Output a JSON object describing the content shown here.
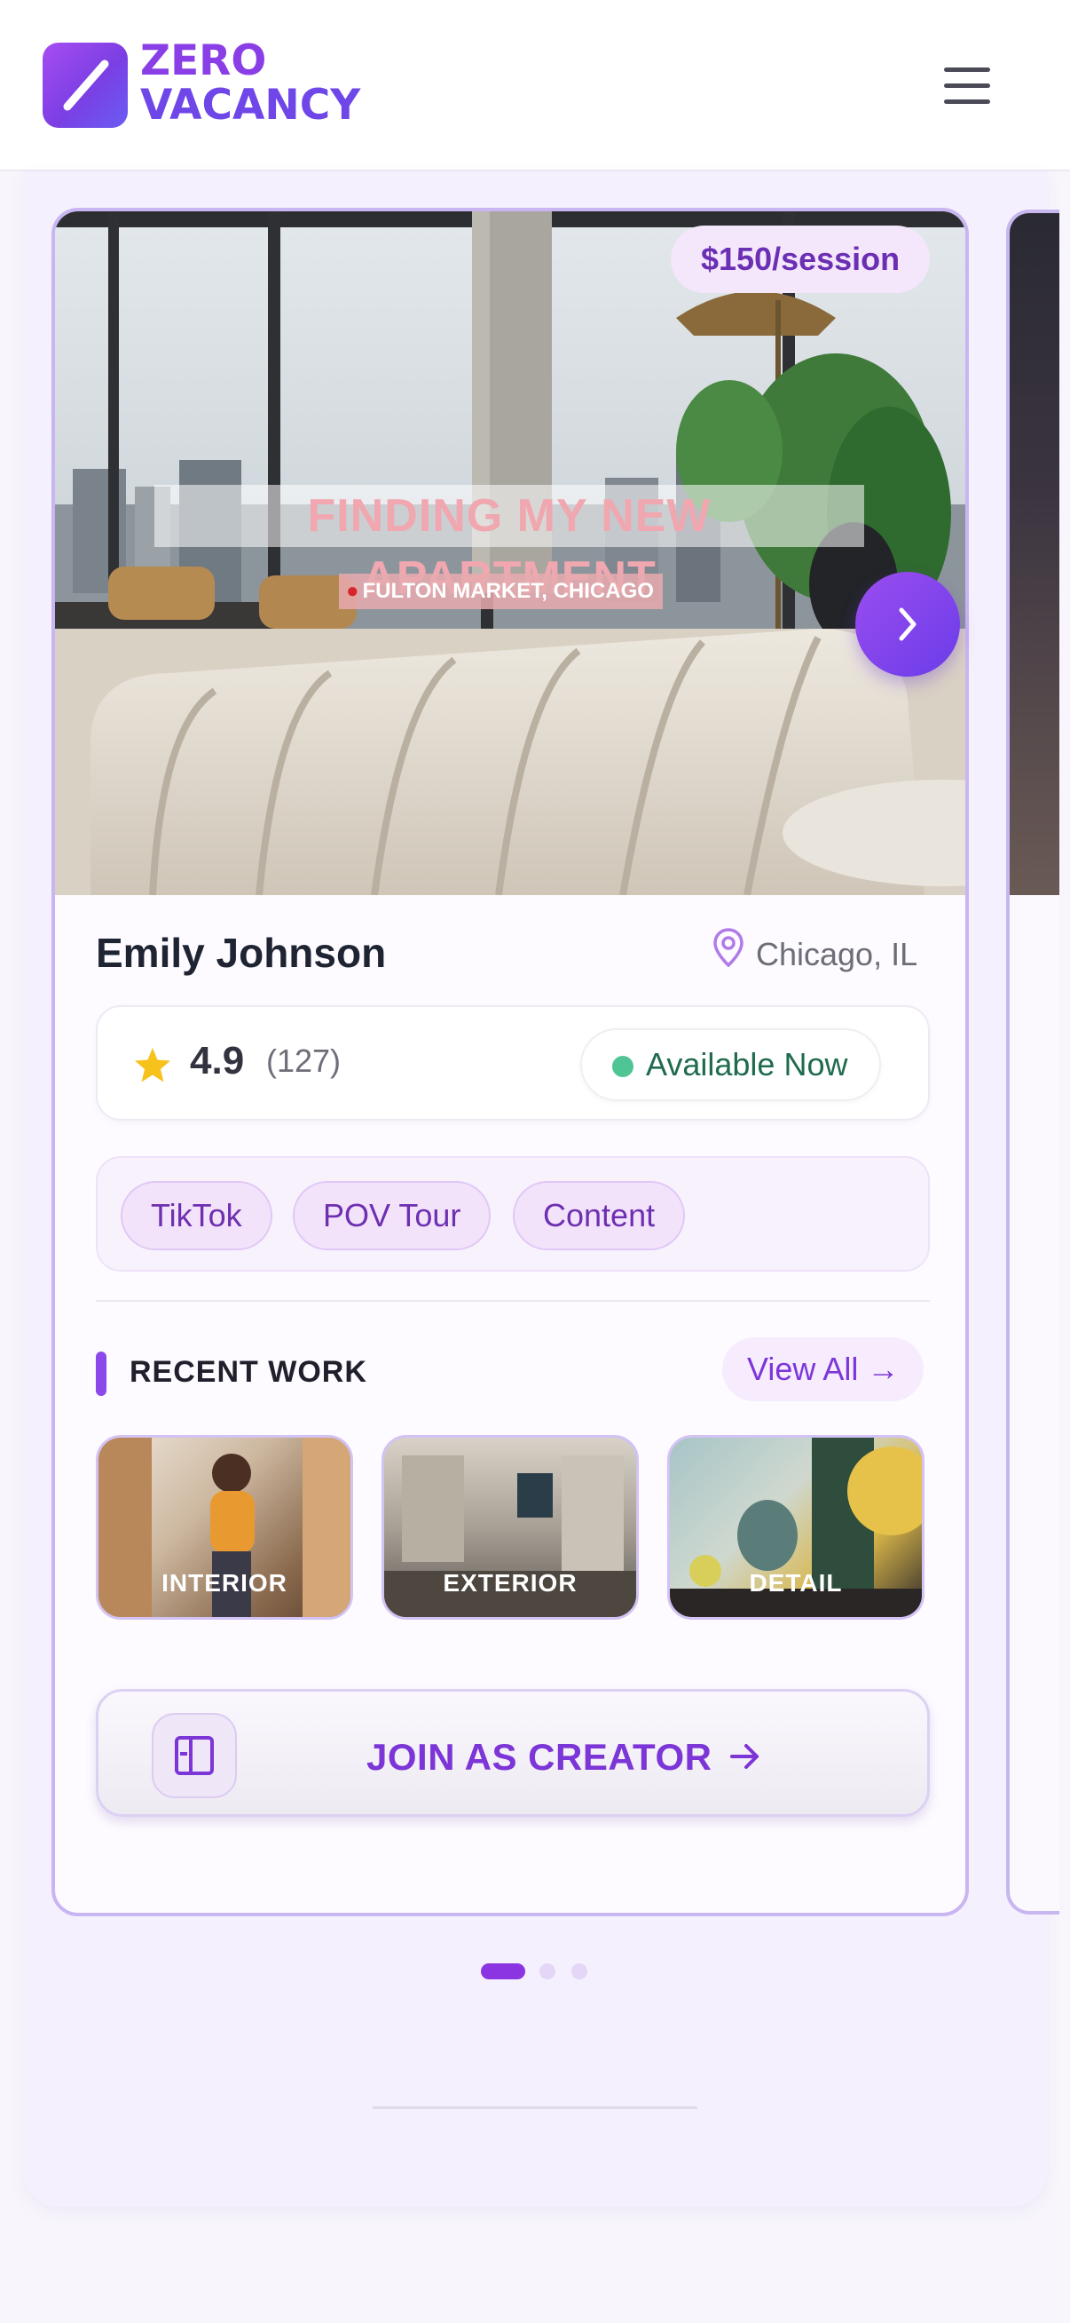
{
  "brand": {
    "line1": "ZERO",
    "line2": "VACANCY",
    "colors": {
      "primary": "#8a3fe6",
      "secondary": "#6f47e8"
    }
  },
  "header": {
    "menu_icon": "hamburger-menu-icon"
  },
  "listing": {
    "price": "$150/session",
    "hero_title": "FINDING MY NEW APARTMENT",
    "hero_location": "FULTON MARKET, CHICAGO",
    "creator_name": "Emily Johnson",
    "location": "Chicago, IL",
    "rating": "4.9",
    "review_count": "(127)",
    "availability": "Available Now",
    "tags": [
      "TikTok",
      "POV Tour",
      "Content"
    ]
  },
  "recent_work": {
    "title": "RECENT WORK",
    "view_all": "View All →",
    "items": [
      "INTERIOR",
      "EXTERIOR",
      "DETAIL"
    ]
  },
  "cta": {
    "label": "JOIN AS CREATOR"
  },
  "carousel": {
    "current_page": 1,
    "total_pages": 3
  }
}
